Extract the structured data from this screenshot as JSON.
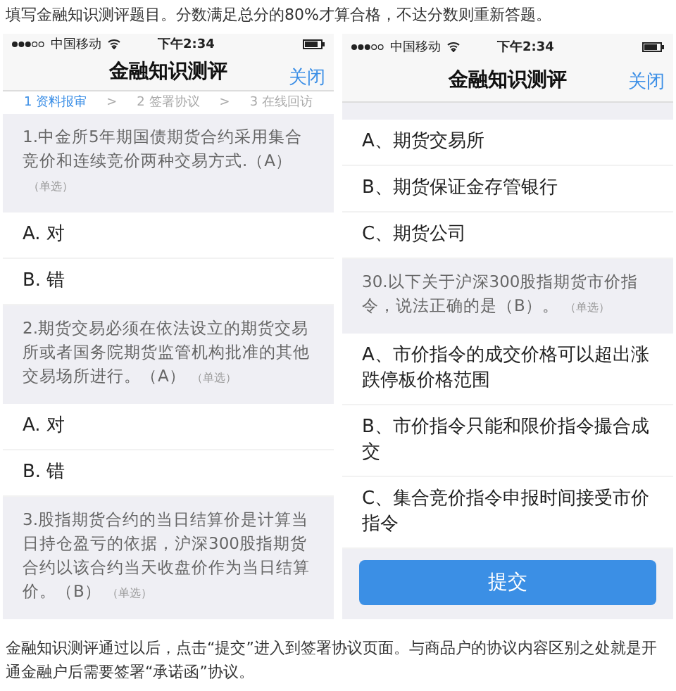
{
  "intro": "填写金融知识测评题目。分数满足总分的80%才算合格，不达分数则重新答题。",
  "phones": [
    {
      "status": {
        "carrier": "中国移动",
        "time": "下午2:34"
      },
      "nav": {
        "title": "金融知识测评",
        "close": "关闭"
      },
      "steps": {
        "separator": ">",
        "items": [
          {
            "label": "1 资料报审",
            "selected": true
          },
          {
            "label": "2 签署协议",
            "selected": false
          },
          {
            "label": "3 在线回访",
            "selected": false
          }
        ]
      },
      "items": [
        {
          "kind": "question",
          "text": "1.中金所5年期国债期货合约采用集合竞价和连续竞价两种交易方式.（A）",
          "tag": "（单选）"
        },
        {
          "kind": "option",
          "text": "A. 对"
        },
        {
          "kind": "option",
          "text": "B. 错"
        },
        {
          "kind": "question",
          "text": "2.期货交易必须在依法设立的期货交易所或者国务院期货监管机构批准的其他交易场所进行。（A）",
          "tag": "（单选）"
        },
        {
          "kind": "option",
          "text": "A. 对"
        },
        {
          "kind": "option",
          "text": "B. 错"
        },
        {
          "kind": "question",
          "text": "3.股指期货合约的当日结算价是计算当日持仓盈亏的依据，沪深300股指期货合约以该合约当天收盘价作为当日结算价。（B）",
          "tag": "（单选）"
        }
      ]
    },
    {
      "status": {
        "carrier": "中国移动",
        "time": "下午2:34"
      },
      "nav": {
        "title": "金融知识测评",
        "close": "关闭"
      },
      "items": [
        {
          "kind": "gap"
        },
        {
          "kind": "option",
          "text": "A、期货交易所"
        },
        {
          "kind": "option",
          "text": "B、期货保证金存管银行"
        },
        {
          "kind": "option",
          "text": "C、期货公司"
        },
        {
          "kind": "question",
          "text": "30.以下关于沪深300股指期货市价指令，说法正确的是（B）。",
          "tag": "（单选）"
        },
        {
          "kind": "option",
          "text": "A、市价指令的成交价格可以超出涨跌停板价格范围"
        },
        {
          "kind": "option",
          "text": "B、市价指令只能和限价指令撮合成交"
        },
        {
          "kind": "option",
          "text": "C、集合竞价指令申报时间接受市价指令"
        }
      ],
      "submit": "提交"
    }
  ],
  "outro": "金融知识测评通过以后，点击“提交”进入到签署协议页面。与商品户的协议内容区别之处就是开通金融户后需要签署“承诺函”协议。"
}
